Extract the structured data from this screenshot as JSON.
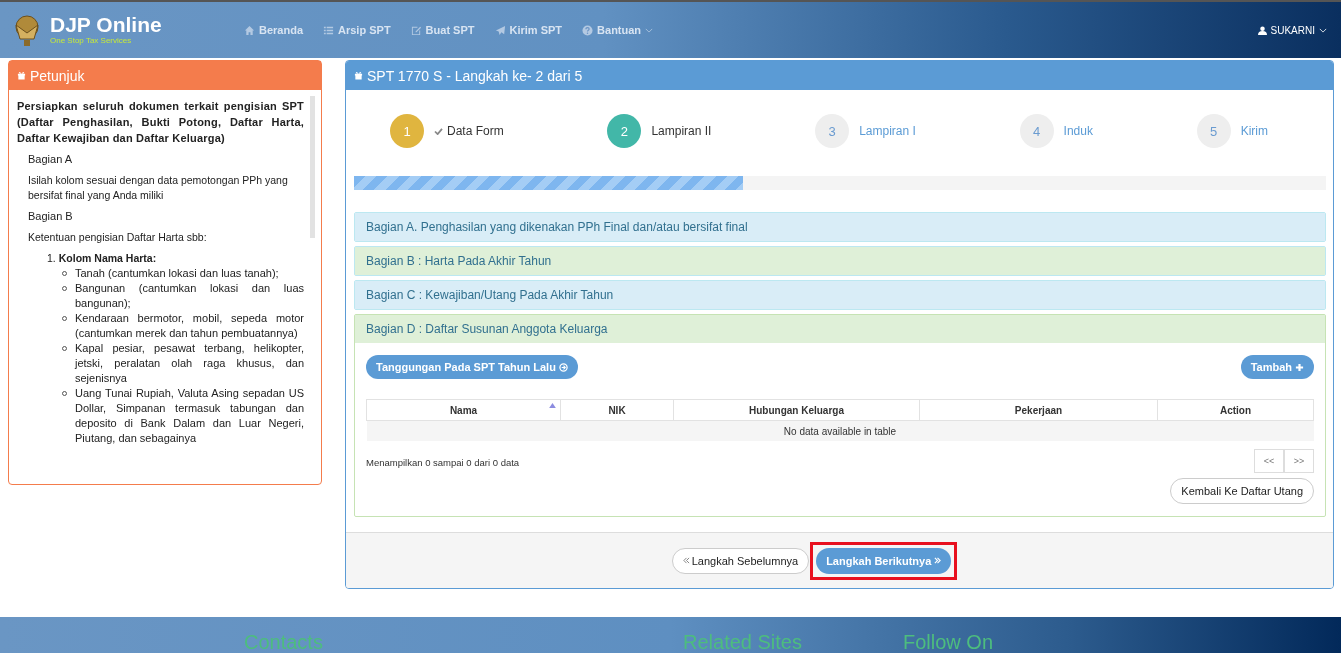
{
  "header": {
    "brand": "DJP Online",
    "tagline": "One Stop Tax Services",
    "nav": [
      {
        "label": "Beranda",
        "dropdown": false
      },
      {
        "label": "Arsip SPT",
        "dropdown": false
      },
      {
        "label": "Buat SPT",
        "dropdown": false
      },
      {
        "label": "Kirim SPT",
        "dropdown": false
      },
      {
        "label": "Bantuan",
        "dropdown": true
      }
    ],
    "user": "SUKARNI"
  },
  "guide": {
    "title": "Petunjuk",
    "intro": "Persiapkan seluruh dokumen terkait pengisian SPT (Daftar Penghasilan, Bukti Potong, Daftar Harta, Daftar Kewajiban dan Daftar Keluarga)",
    "sections": [
      {
        "heading": "Bagian A",
        "text": "Isilah kolom sesuai dengan data pemotongan PPh yang bersifat final yang Anda miliki"
      },
      {
        "heading": "Bagian B",
        "text": "Ketentuan pengisian Daftar Harta sbb:"
      }
    ],
    "list_number": "1.",
    "list_title": "Kolom Nama Harta:",
    "bullets": [
      "Tanah (cantumkan lokasi dan luas tanah);",
      "Bangunan (cantumkan lokasi dan luas bangunan);",
      "Kendaraan bermotor, mobil, sepeda motor (cantumkan merek dan tahun pembuatannya)",
      "Kapal pesiar, pesawat terbang, helikopter, jetski, peralatan olah raga khusus, dan sejenisnya",
      "Uang Tunai Rupiah, Valuta Asing sepadan US Dollar, Simpanan termasuk tabungan dan deposito di Bank Dalam dan Luar Negeri, Piutang, dan sebagainya"
    ]
  },
  "wizard": {
    "title": "SPT 1770 S - Langkah ke- 2 dari 5",
    "steps": [
      {
        "number": "1",
        "label": "Data Form",
        "done": true,
        "selected": false
      },
      {
        "number": "2",
        "label": "Lampiran II",
        "done": false,
        "selected": true
      },
      {
        "number": "3",
        "label": "Lampiran I",
        "done": false,
        "selected": false
      },
      {
        "number": "4",
        "label": "Induk",
        "done": false,
        "selected": false
      },
      {
        "number": "5",
        "label": "Kirim",
        "done": false,
        "selected": false
      }
    ],
    "progress": {
      "level": 0.4
    },
    "sections": [
      {
        "title": "Bagian A. Penghasilan yang dikenakan PPh Final dan/atau bersifat final",
        "color": "#d9edf7",
        "expanded": false
      },
      {
        "title": "Bagian B : Harta Pada Akhir Tahun",
        "color": "#dff0d8",
        "expanded": false
      },
      {
        "title": "Bagian C : Kewajiban/Utang Pada Akhir Tahun",
        "color": "#d9edf7",
        "expanded": false
      },
      {
        "title": "Bagian D : Daftar Susunan Anggota Keluarga",
        "color": "#dff0d8",
        "expanded": true
      }
    ],
    "prev_year_button": "Tanggungan Pada SPT Tahun Lalu",
    "add_button": "Tambah",
    "table": {
      "columns": [
        {
          "label": "Nama",
          "sorted": true
        },
        {
          "label": "NIK",
          "sorted": false
        },
        {
          "label": "Hubungan Keluarga",
          "sorted": false
        },
        {
          "label": "Pekerjaan",
          "sorted": false
        },
        {
          "label": "Action",
          "sorted": false
        }
      ],
      "empty": "No data available in table"
    },
    "info": "Menampilkan 0 sampai 0 dari 0 data",
    "pager": [
      "<<",
      ">>"
    ],
    "back_button": "Kembali Ke Daftar Utang",
    "prev_button": "Langkah Sebelumnya",
    "next_button": "Langkah Berikutnya",
    "next_highlighted": true
  },
  "footer": {
    "headings": [
      "Contacts",
      "Related Sites",
      "Follow On"
    ]
  }
}
